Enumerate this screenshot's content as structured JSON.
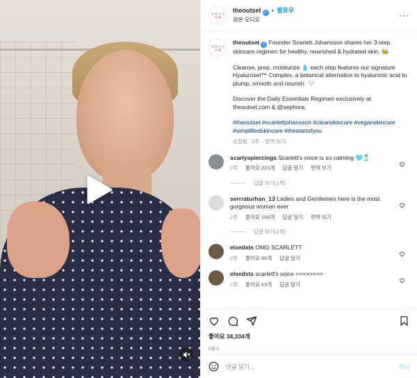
{
  "header": {
    "username": "theoutset",
    "separator": "•",
    "follow_label": "팔로우",
    "subline": "원본 오디오",
    "more_label": "···"
  },
  "post": {
    "username": "theoutset",
    "intro": "Founder Scarlett Johansson shares her 3-step skincare regimen for healthy, nourished & hydrated skin. 🐝",
    "paragraph2": "Cleanse, prep, moisturize 💧 each step features our signature Hyaluroset™ Complex, a botanical alternative to hyaluronic acid to plump, smooth and nourish. 🤍",
    "paragraph3": "Discover the Daily Essentials Regimen exclusively at theoutset.com & @sephora.",
    "hashtags": "#theoutset #scarlettjohansson #cleanskincare #veganskincare #simplifiedskincare #thestartofyou",
    "edited": "수정됨 · 2주",
    "translate": "번역 보기"
  },
  "comments": [
    {
      "username": "scarlyspiercings",
      "text": "Scarlett's voice is so calming 🩵🫙",
      "time": "2주",
      "likes": "좋아요 223개",
      "reply": "답글 달기",
      "translate": "번역 보기",
      "replies": "답글 보기(1개)",
      "avatar_color": "#8a8f96"
    },
    {
      "username": "serrraturhan_13",
      "text": "Ladies and Gentlemen here is the most gorgeous woman ever",
      "time": "2주",
      "likes": "좋아요 108개",
      "reply": "답글 달기",
      "translate": "번역 보기",
      "replies": "답글 보기(2개)",
      "avatar_color": "#dbdbdb"
    },
    {
      "username": "elxedxts",
      "text": "OMG SCARLETT",
      "time": "2주",
      "likes": "좋아요 96개",
      "reply": "답글 달기",
      "translate": "",
      "replies": "",
      "avatar_color": "#6d5a45"
    },
    {
      "username": "elxedxts",
      "text": "scarlett's voice >>>>>>>>",
      "time": "2주",
      "likes": "좋아요 63개",
      "reply": "답글 달기",
      "translate": "",
      "replies": "",
      "avatar_color": "#6d5a45"
    }
  ],
  "actions": {
    "likes": "좋아요 34,334개",
    "date": "8월 6"
  },
  "comment_bar": {
    "placeholder": "댓글 달기...",
    "post_label": "게시"
  },
  "icons": [
    "play-icon",
    "mute-icon",
    "heart-icon",
    "comment-icon",
    "share-icon",
    "bookmark-icon",
    "emoji-icon",
    "verified-icon",
    "more-icon"
  ],
  "colors": {
    "accent": "#0095f6",
    "hashtag": "#00376b",
    "muted": "#8e8e8e",
    "post_disabled": "#b2dffc"
  }
}
